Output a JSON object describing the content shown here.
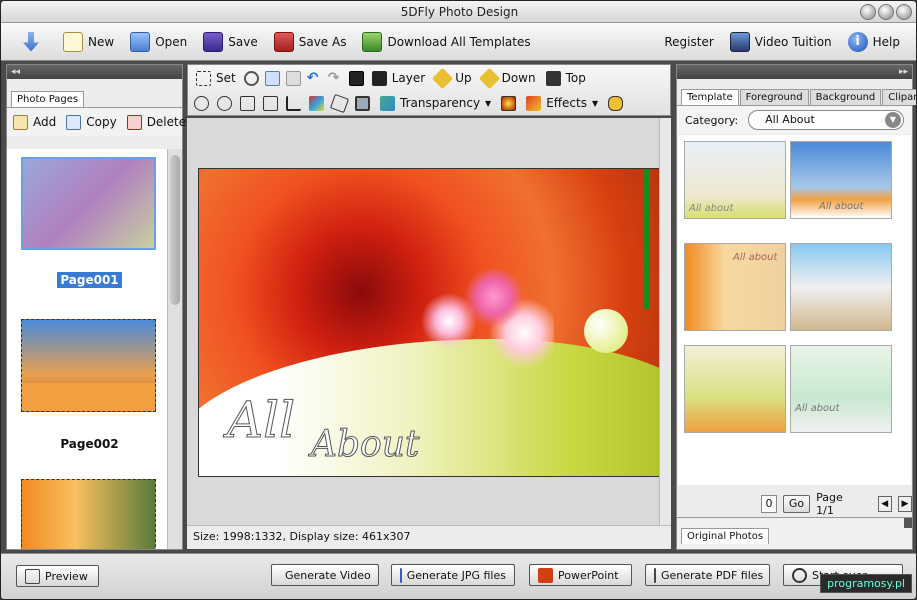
{
  "window": {
    "title": "5DFly Photo Design"
  },
  "toolbar": {
    "items": [
      {
        "label": "New"
      },
      {
        "label": "Open"
      },
      {
        "label": "Save"
      },
      {
        "label": "Save As"
      },
      {
        "label": "Download All Templates"
      }
    ],
    "right": [
      {
        "label": "Register"
      },
      {
        "label": "Video Tuition"
      },
      {
        "label": "Help"
      }
    ]
  },
  "left_panel": {
    "tab": "Photo Pages",
    "actions": [
      {
        "label": "Add"
      },
      {
        "label": "Copy"
      },
      {
        "label": "Delete"
      }
    ],
    "pages": [
      {
        "label": "Page001",
        "selected": true
      },
      {
        "label": "Page002",
        "selected": false
      }
    ]
  },
  "edit_toolbar": {
    "row1": [
      {
        "label": "Set"
      },
      {
        "label": "Layer"
      },
      {
        "label": "Up"
      },
      {
        "label": "Down"
      },
      {
        "label": "Top"
      }
    ],
    "row2": [
      {
        "label": "Transparency"
      },
      {
        "label": "Effects"
      }
    ]
  },
  "canvas": {
    "text_line1": "All",
    "text_line2": "About"
  },
  "status": {
    "text": "Size: 1998:1332, Display size: 461x307"
  },
  "right_panel": {
    "tabs": [
      {
        "label": "Template"
      },
      {
        "label": "Foreground"
      },
      {
        "label": "Background"
      },
      {
        "label": "Clipart"
      }
    ],
    "category_label": "Category:",
    "category_value": "All About",
    "page_input": "0",
    "go_label": "Go",
    "page_info": "Page 1/1",
    "bottom_tab": "Original Photos",
    "thumb_text": "All about"
  },
  "bottom": {
    "preview": "Preview",
    "buttons": [
      {
        "label": "Generate Video"
      },
      {
        "label": "Generate JPG files"
      },
      {
        "label": "PowerPoint"
      },
      {
        "label": "Generate PDF files"
      },
      {
        "label": "Start over"
      }
    ],
    "watermark": "programosy.pl"
  },
  "colors": {
    "accent": "#2a6fdb",
    "selected_bg": "#3a7bd5"
  }
}
